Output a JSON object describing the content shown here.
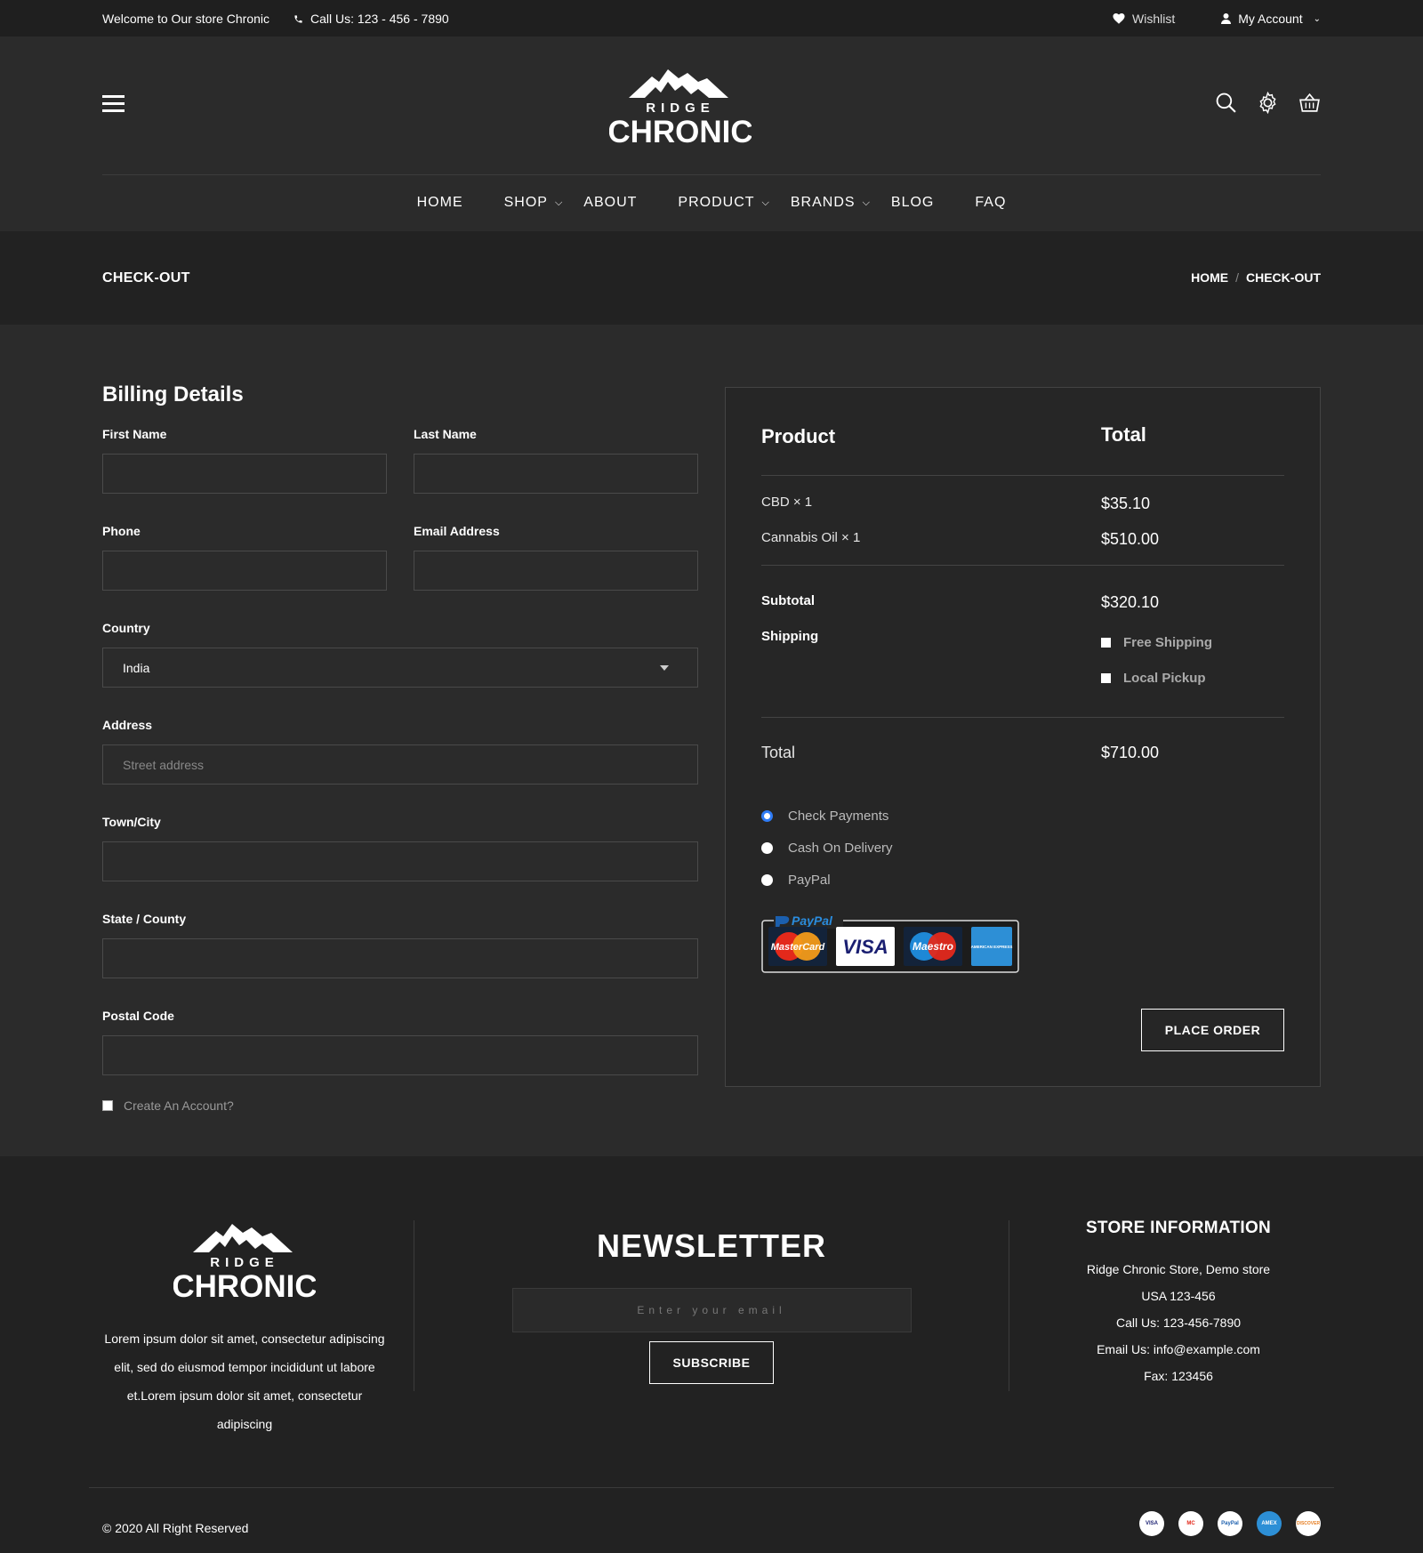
{
  "topbar": {
    "welcome": "Welcome to Our store Chronic",
    "call": "Call Us: 123 - 456 - 7890",
    "wishlist": "Wishlist",
    "account": "My Account"
  },
  "logo": {
    "line1": "RIDGE",
    "line2": "CHRONIC"
  },
  "nav": {
    "items": [
      {
        "label": "HOME",
        "dropdown": false
      },
      {
        "label": "SHOP",
        "dropdown": true
      },
      {
        "label": "ABOUT",
        "dropdown": false
      },
      {
        "label": "PRODUCT",
        "dropdown": true
      },
      {
        "label": "BRANDS",
        "dropdown": true
      },
      {
        "label": "BLOG",
        "dropdown": false
      },
      {
        "label": "FAQ",
        "dropdown": false
      }
    ]
  },
  "breadcrumb": {
    "title": "CHECK-OUT",
    "home": "HOME",
    "sep": "/",
    "current": "CHECK-OUT"
  },
  "billing": {
    "heading": "Billing Details",
    "first_name": {
      "label": "First Name",
      "value": ""
    },
    "last_name": {
      "label": "Last Name",
      "value": ""
    },
    "phone": {
      "label": "Phone",
      "value": ""
    },
    "email": {
      "label": "Email Address",
      "value": ""
    },
    "country": {
      "label": "Country",
      "value": "India"
    },
    "address": {
      "label": "Address",
      "placeholder": "Street address"
    },
    "town": {
      "label": "Town/City",
      "value": ""
    },
    "state": {
      "label": "State / County",
      "value": ""
    },
    "postal": {
      "label": "Postal Code",
      "value": ""
    },
    "create_account": "Create An Account?"
  },
  "order": {
    "col_product": "Product",
    "col_total": "Total",
    "items": [
      {
        "name": "CBD × 1",
        "price": "$35.10"
      },
      {
        "name": "Cannabis Oil × 1",
        "price": "$510.00"
      }
    ],
    "subtotal_label": "Subtotal",
    "subtotal": "$320.10",
    "shipping_label": "Shipping",
    "shipping_options": [
      "Free Shipping",
      "Local Pickup"
    ],
    "total_label": "Total",
    "total": "$710.00",
    "payments": [
      {
        "label": "Check Payments",
        "selected": true
      },
      {
        "label": "Cash On Delivery",
        "selected": false
      },
      {
        "label": "PayPal",
        "selected": false
      }
    ],
    "card_logos": {
      "brand": "PayPal",
      "cards": [
        "MasterCard",
        "VISA",
        "Maestro",
        "AMERICAN EXPRESS"
      ]
    },
    "place_order": "PLACE ORDER"
  },
  "footer": {
    "about": "Lorem ipsum dolor sit amet, consectetur adipiscing elit, sed do eiusmod tempor incididunt ut labore et.Lorem ipsum dolor sit amet, consectetur adipiscing",
    "newsletter_title": "NEWSLETTER",
    "email_placeholder": "Enter your email",
    "subscribe": "SUBSCRIBE",
    "store_title": "STORE INFORMATION",
    "store_lines": [
      "Ridge Chronic Store, Demo store",
      "USA 123-456",
      "Call Us: 123-456-7890",
      "Email Us: info@example.com",
      "Fax: 123456"
    ],
    "copyright": "© 2020 All Right Reserved",
    "mini_cards": [
      "VISA",
      "MC",
      "PayPal",
      "AMEX",
      "DISCOVER"
    ]
  },
  "colors": {
    "bg": "#2b2b2b",
    "topbar": "#1f1f1f",
    "panel": "#262626",
    "accent_radio": "#2f7cf6"
  }
}
